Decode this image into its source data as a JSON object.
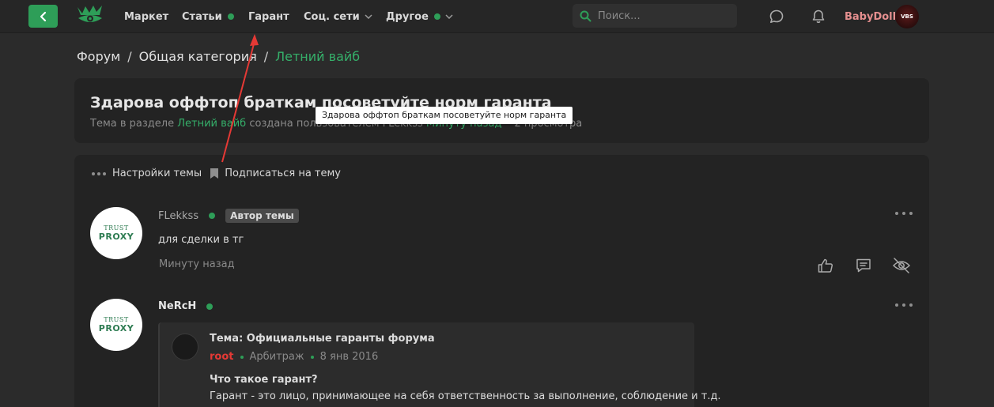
{
  "nav": {
    "items": [
      "Маркет",
      "Статьи",
      "Гарант",
      "Соц. сети",
      "Другое"
    ],
    "search_placeholder": "Поиск...",
    "username": "BabyDoll",
    "avatar_text": "VBS",
    "accent": "#2e9e58"
  },
  "breadcrumb": [
    "Форум",
    "Общая категория",
    "Летний вайб"
  ],
  "thread": {
    "title": "Здарова оффтоп браткам посоветуйте норм гаранта",
    "meta_prefix": "Тема в разделе",
    "meta_section": "Летний вайб",
    "meta_mid": "создана пользователем",
    "meta_author": "FLekkss",
    "meta_time": "Минуту назад",
    "meta_sep": "•",
    "meta_views": "2 просмотра",
    "tooltip": "Здарова оффтоп браткам посоветуйте норм гаранта",
    "settings_label": "Настройки темы",
    "subscribe_label": "Подписаться на тему"
  },
  "posts": [
    {
      "author": "FLekkss",
      "badge": "Автор темы",
      "text": "для сделки в тг",
      "time": "Минуту назад",
      "avatar_top": "TRUST",
      "avatar_bottom": "PROXY"
    },
    {
      "author": "NeRcH",
      "avatar_top": "TRUST",
      "avatar_bottom": "PROXY",
      "quote": {
        "title": "Тема: Официальные гаранты форума",
        "user": "root",
        "section": "Арбитраж",
        "date": "8 янв 2016",
        "heading": "Что такое гарант?",
        "body": "Гарант - это лицо, принимающее на себя ответственность за выполнение, соблюдение и т.д."
      }
    }
  ]
}
